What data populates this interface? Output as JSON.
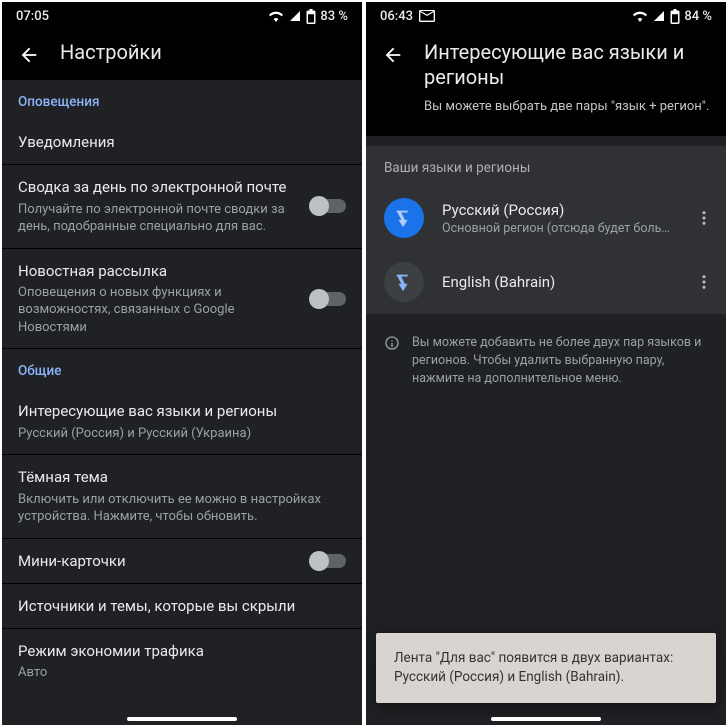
{
  "left": {
    "status": {
      "time": "07:05",
      "battery": "83 %"
    },
    "title": "Настройки",
    "sections": {
      "alerts_header": "Оповещения",
      "notifications": {
        "title": "Уведомления"
      },
      "daily_digest": {
        "title": "Сводка за день по электронной почте",
        "sub": "Получайте по электронной почте сводки за день, подобранные специально для вас."
      },
      "newsletter": {
        "title": "Новостная рассылка",
        "sub": "Оповещения о новых функциях и возможностях, связанных с Google Новостями"
      },
      "general_header": "Общие",
      "languages": {
        "title": "Интересующие вас языки и регионы",
        "sub": "Русский (Россия) и Русский (Украина)"
      },
      "dark_theme": {
        "title": "Тёмная тема",
        "sub": "Включить или отключить ее можно в настройках устройства. Нажмите, чтобы обновить."
      },
      "mini_cards": {
        "title": "Мини-карточки"
      },
      "hidden_sources": {
        "title": "Источники и темы, которые вы скрыли"
      },
      "data_saver": {
        "title": "Режим экономии трафика",
        "sub": "Авто"
      }
    }
  },
  "right": {
    "status": {
      "time": "06:43",
      "battery": "84 %"
    },
    "title": "Интересующие вас языки и регионы",
    "subtitle": "Вы можете выбрать две пары \"язык + регион\".",
    "list_header": "Ваши языки и регионы",
    "langs": [
      {
        "title": "Русский (Россия)",
        "sub": "Основной регион (отсюда будет больше …"
      },
      {
        "title": "English (Bahrain)",
        "sub": ""
      }
    ],
    "info": "Вы можете добавить не более двух пар языков и регионов. Чтобы удалить выбранную пару, нажмите на дополнительное меню.",
    "toast": "Лента \"Для вас\" появится в двух вариантах: Русский (Россия) и English (Bahrain)."
  }
}
